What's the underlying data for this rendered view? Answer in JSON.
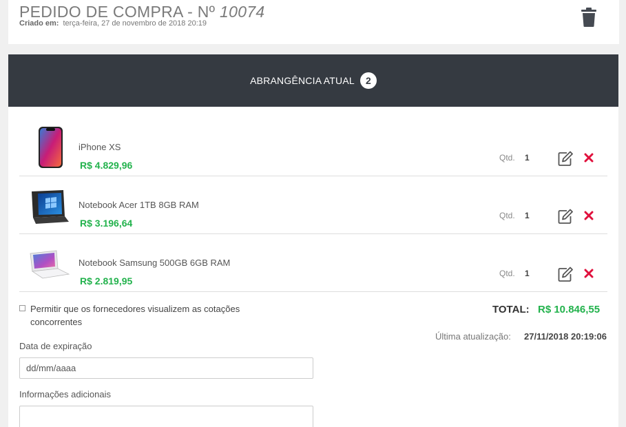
{
  "order": {
    "title_prefix": "PEDIDO DE COMPRA - Nº ",
    "number": "10074",
    "created_label": "Criado em:",
    "created_value": "terça-feira, 27 de novembro de 2018 20:19"
  },
  "scope": {
    "label": "ABRANGÊNCIA ATUAL",
    "count": "2"
  },
  "items": [
    {
      "name": "iPhone XS",
      "price": "R$ 4.829,96",
      "qtd_label": "Qtd.",
      "qtd": "1",
      "thumb_icon": "iphone-xs-image"
    },
    {
      "name": "Notebook Acer 1TB 8GB RAM",
      "price": "R$ 3.196,64",
      "qtd_label": "Qtd.",
      "qtd": "1",
      "thumb_icon": "acer-notebook-image"
    },
    {
      "name": "Notebook Samsung 500GB 6GB RAM",
      "price": "R$ 2.819,95",
      "qtd_label": "Qtd.",
      "qtd": "1",
      "thumb_icon": "samsung-notebook-image"
    }
  ],
  "permissions": {
    "text": "Permitir que os fornecedores visualizem as cotações concorrentes",
    "checked": false
  },
  "summary": {
    "total_label": "TOTAL:",
    "total_value": "R$ 10.846,55",
    "updated_label": "Última atualização:",
    "updated_value": "27/11/2018 20:19:06"
  },
  "form": {
    "expiration_label": "Data de expiração",
    "expiration_placeholder": "dd/mm/aaaa",
    "info_label": "Informações adicionais"
  },
  "colors": {
    "accent_green": "#22b24c",
    "remove_red": "#e0103c",
    "scope_bar": "#353a41"
  }
}
